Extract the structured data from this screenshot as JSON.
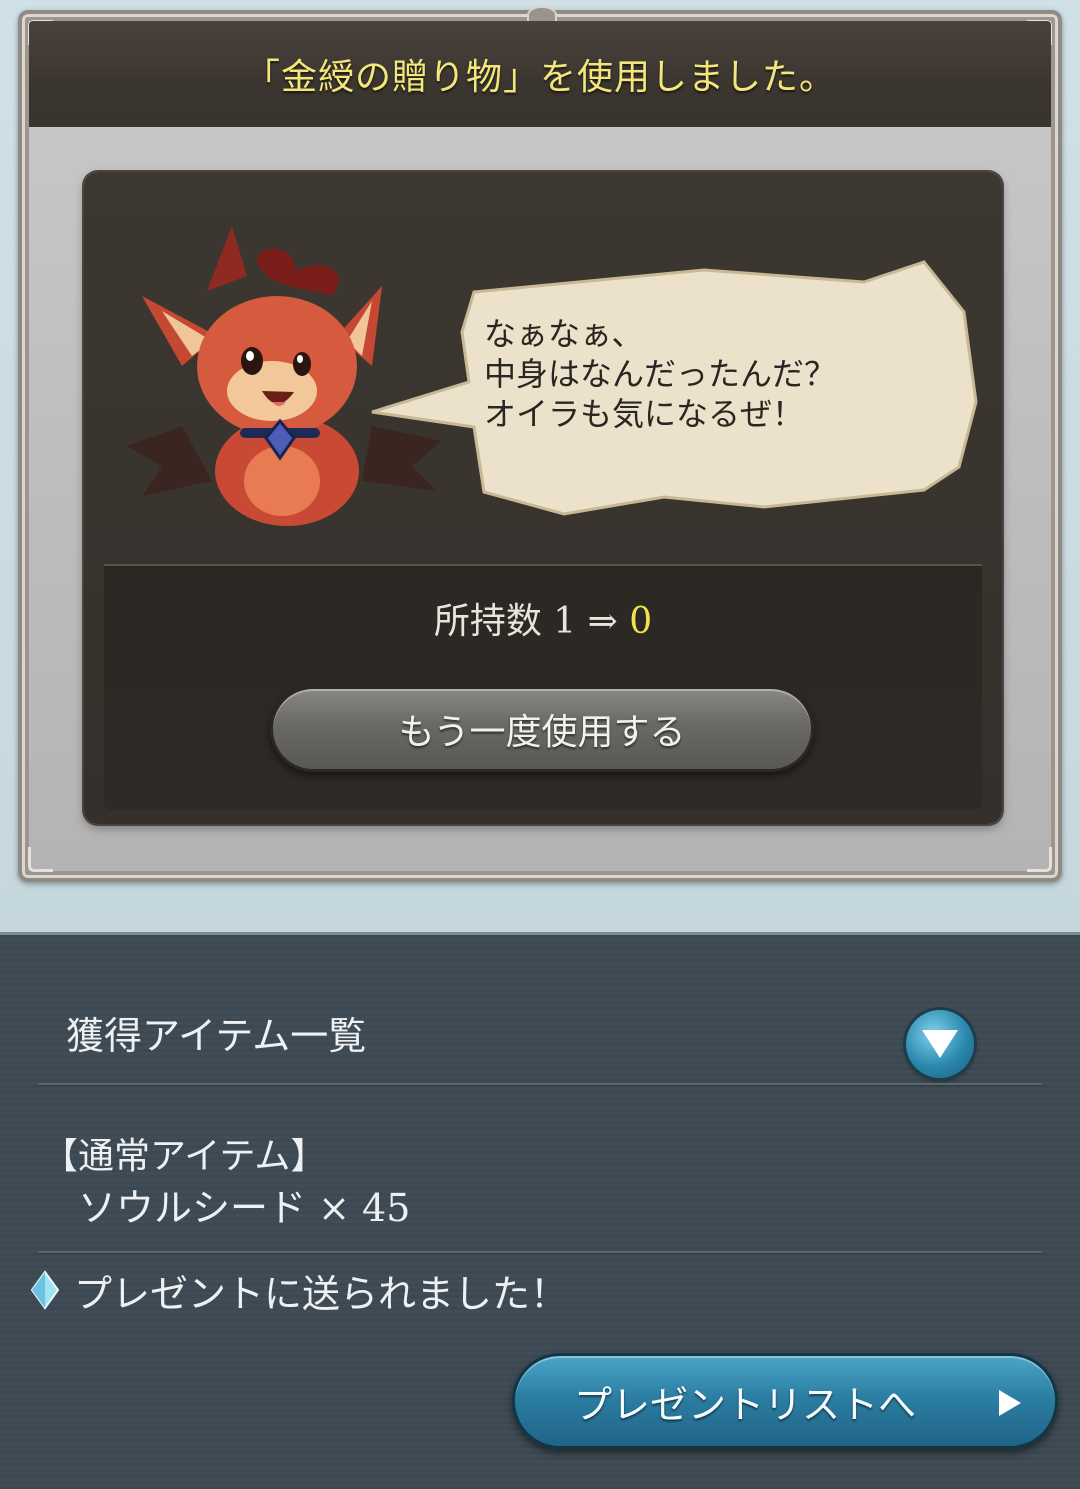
{
  "dialog": {
    "title": "「金綬の贈り物」を使用しました。",
    "speech_lines": [
      "なぁなぁ、",
      "中身はなんだったんだ？",
      "オイラも気になるぜ！"
    ],
    "count_label": "所持数",
    "count_before": "1",
    "count_arrow": "⇒",
    "count_after": "0",
    "reuse_button_label": "もう一度使用する"
  },
  "results": {
    "header": "獲得アイテム一覧",
    "category": "【通常アイテム】",
    "item_name": "ソウルシード",
    "item_multiplier": "×",
    "item_qty": "45",
    "sent_message": "プレゼントに送られました！",
    "present_button_label": "プレゼントリストへ"
  },
  "icons": {
    "toggle": "triangle-down-icon",
    "sent_bullet": "diamond-icon",
    "present_arrow": "play-arrow-icon"
  },
  "colors": {
    "title_yellow": "#f3e67a",
    "count_after_yellow": "#f2e34a",
    "accent_blue": "#2c7ea3"
  }
}
